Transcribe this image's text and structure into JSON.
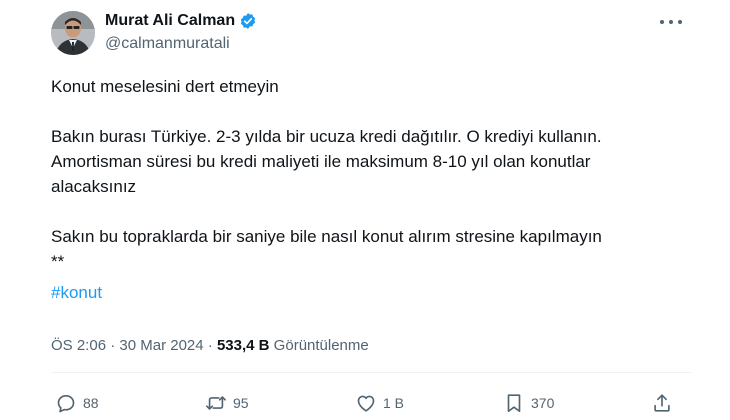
{
  "author": {
    "display_name": "Murat Ali Calman",
    "handle": "@calmanmuratali",
    "verified": true
  },
  "tweet": {
    "paragraph_1": "Konut meselesini dert etmeyin",
    "paragraph_2": "Bakın burası Türkiye. 2-3 yılda bir ucuza kredi dağıtılır. O krediyi kullanın.\nAmortisman süresi bu kredi maliyeti ile maksimum 8-10 yıl olan konutlar\nalacaksınız",
    "paragraph_3": "Sakın bu topraklarda bir saniye bile nasıl konut alırım stresine kapılmayın\n**",
    "hashtag": "#konut"
  },
  "meta": {
    "time": "ÖS 2:06",
    "separator": " · ",
    "date": "30 Mar 2024",
    "views_count": "533,4 B",
    "views_label": " Görüntülenme"
  },
  "actions": {
    "replies": "88",
    "reposts": "95",
    "likes": "1 B",
    "bookmarks": "370"
  },
  "colors": {
    "accent": "#1d9bf0",
    "secondary_text": "#536471",
    "primary_text": "#0f1419"
  },
  "icons": [
    "verified-badge-icon",
    "more-options-icon",
    "reply-icon",
    "repost-icon",
    "like-icon",
    "bookmark-icon",
    "share-icon"
  ]
}
